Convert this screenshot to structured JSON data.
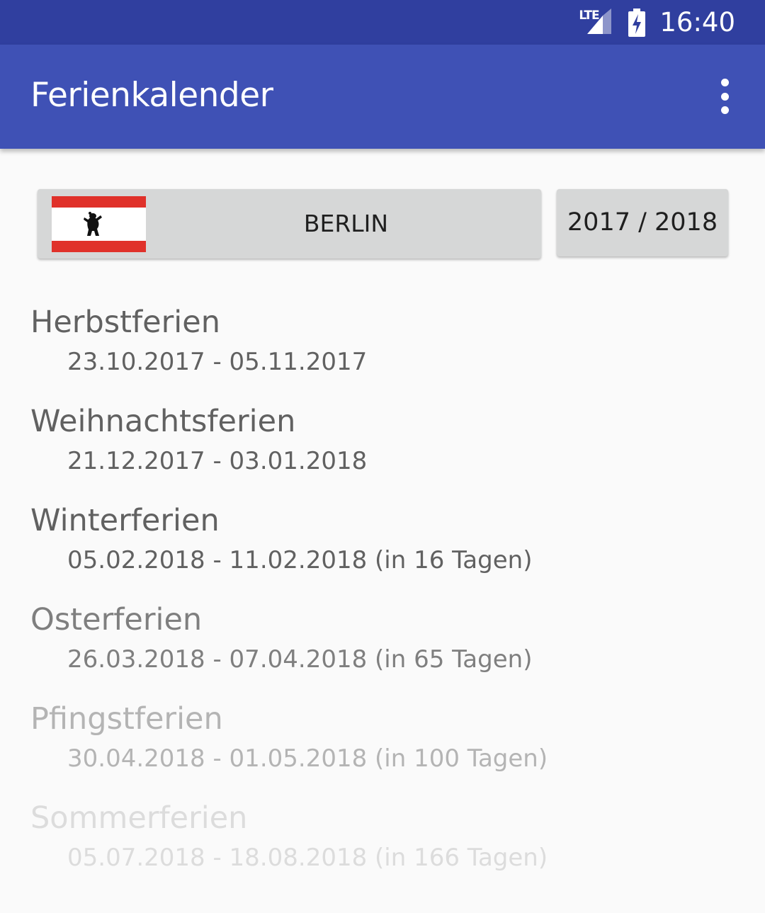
{
  "status_bar": {
    "network_label": "LTE",
    "clock": "16:40",
    "icons": [
      "lte-signal-icon",
      "battery-charging-icon"
    ],
    "background_color": "#303f9f"
  },
  "app_bar": {
    "title": "Ferienkalender",
    "menu_icon": "more-vert-icon",
    "background_color": "#3f51b5"
  },
  "selectors": {
    "state": {
      "label": "BERLIN",
      "flag_icon": "berlin-flag-icon"
    },
    "year": {
      "label": "2017 / 2018"
    }
  },
  "holidays": [
    {
      "name": "Herbstferien",
      "dates": "23.10.2017 - 05.11.2017",
      "color": "#616161"
    },
    {
      "name": "Weihnachtsferien",
      "dates": "21.12.2017 - 03.01.2018",
      "color": "#616161"
    },
    {
      "name": "Winterferien",
      "dates": "05.02.2018 - 11.02.2018 (in 16 Tagen)",
      "color": "#616161"
    },
    {
      "name": "Osterferien",
      "dates": "26.03.2018 - 07.04.2018 (in 65 Tagen)",
      "color": "#7f7f7f"
    },
    {
      "name": "Pfingstferien",
      "dates": "30.04.2018 - 01.05.2018 (in 100 Tagen)",
      "color": "#b4b4b4"
    },
    {
      "name": "Sommerferien",
      "dates": "05.07.2018 - 18.08.2018 (in 166 Tagen)",
      "color": "#dcdcdc"
    }
  ]
}
